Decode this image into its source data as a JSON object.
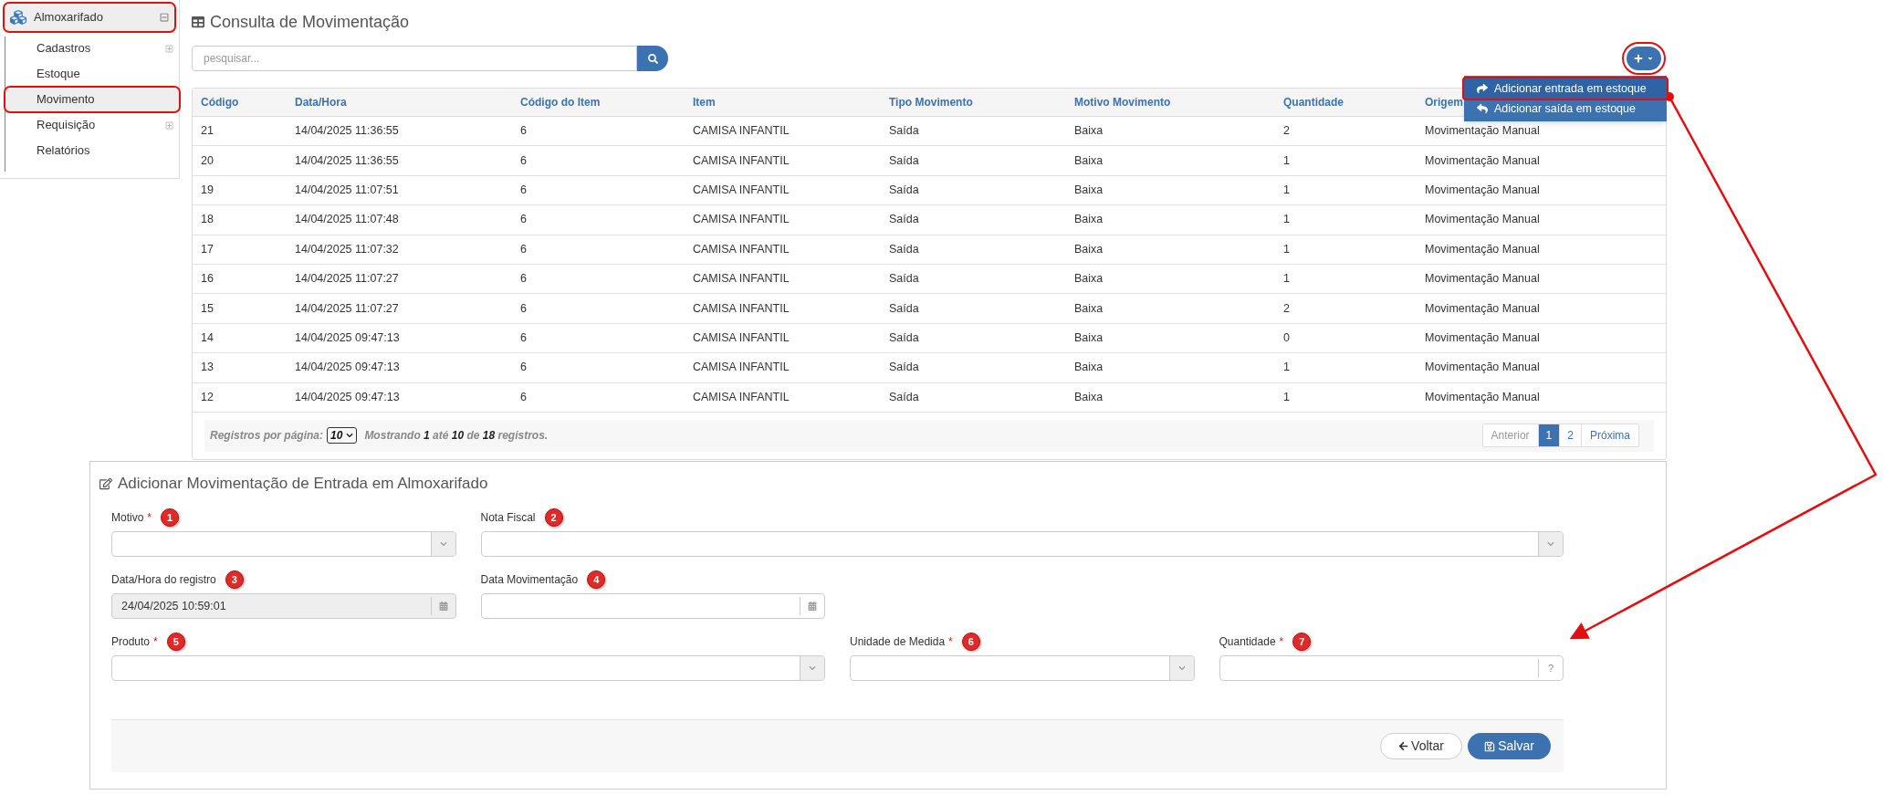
{
  "sidebar": {
    "header": {
      "label": "Almoxarifado",
      "expanded": true,
      "highlighted": true
    },
    "items": [
      {
        "label": "Cadastros",
        "kind": "group",
        "expanded": false,
        "highlighted": false
      },
      {
        "label": "Estoque",
        "kind": "link",
        "highlighted": false
      },
      {
        "label": "Movimento",
        "kind": "link",
        "highlighted": true
      },
      {
        "label": "Requisição",
        "kind": "group",
        "expanded": false,
        "highlighted": false
      },
      {
        "label": "Relatórios",
        "kind": "link",
        "highlighted": false
      }
    ]
  },
  "list": {
    "title": "Consulta de Movimentação",
    "search": {
      "placeholder": "pesquisar..."
    },
    "add_button": {
      "highlighted": true
    },
    "menu": [
      {
        "label": "Adicionar entrada em estoque",
        "kind": "entry",
        "highlighted": true
      },
      {
        "label": "Adicionar saída em estoque",
        "kind": "exit",
        "highlighted": false
      }
    ],
    "table": {
      "columns": [
        "Código",
        "Data/Hora",
        "Código do Item",
        "Item",
        "Tipo Movimento",
        "Motivo Movimento",
        "Quantidade",
        "Origem"
      ],
      "rows": [
        [
          "21",
          "14/04/2025 11:36:55",
          "6",
          "CAMISA INFANTIL",
          "Saída",
          "Baixa",
          "2",
          "Movimentação Manual"
        ],
        [
          "20",
          "14/04/2025 11:36:55",
          "6",
          "CAMISA INFANTIL",
          "Saída",
          "Baixa",
          "1",
          "Movimentação Manual"
        ],
        [
          "19",
          "14/04/2025 11:07:51",
          "6",
          "CAMISA INFANTIL",
          "Saída",
          "Baixa",
          "1",
          "Movimentação Manual"
        ],
        [
          "18",
          "14/04/2025 11:07:48",
          "6",
          "CAMISA INFANTIL",
          "Saída",
          "Baixa",
          "1",
          "Movimentação Manual"
        ],
        [
          "17",
          "14/04/2025 11:07:32",
          "6",
          "CAMISA INFANTIL",
          "Saída",
          "Baixa",
          "1",
          "Movimentação Manual"
        ],
        [
          "16",
          "14/04/2025 11:07:27",
          "6",
          "CAMISA INFANTIL",
          "Saída",
          "Baixa",
          "1",
          "Movimentação Manual"
        ],
        [
          "15",
          "14/04/2025 11:07:27",
          "6",
          "CAMISA INFANTIL",
          "Saída",
          "Baixa",
          "2",
          "Movimentação Manual"
        ],
        [
          "14",
          "14/04/2025 09:47:13",
          "6",
          "CAMISA INFANTIL",
          "Saída",
          "Baixa",
          "0",
          "Movimentação Manual"
        ],
        [
          "13",
          "14/04/2025 09:47:13",
          "6",
          "CAMISA INFANTIL",
          "Saída",
          "Baixa",
          "1",
          "Movimentação Manual"
        ],
        [
          "12",
          "14/04/2025 09:47:13",
          "6",
          "CAMISA INFANTIL",
          "Saída",
          "Baixa",
          "1",
          "Movimentação Manual"
        ]
      ]
    },
    "footer": {
      "per_page_label": "Registros por página:",
      "per_page": "10",
      "summary": "Mostrando **1** até **10** de **18** registros."
    },
    "pagination": [
      {
        "label": "Anterior",
        "kind": "nav",
        "disabled": true,
        "selected": false
      },
      {
        "label": "1",
        "kind": "page",
        "disabled": false,
        "selected": true
      },
      {
        "label": "2",
        "kind": "page",
        "disabled": false,
        "selected": false
      },
      {
        "label": "Próxima",
        "kind": "nav",
        "disabled": false,
        "selected": false
      }
    ]
  },
  "form": {
    "title": "Adicionar Movimentação de Entrada em Almoxarifado",
    "rows": [
      [
        {
          "label": "Motivo",
          "required_mark": "*",
          "marker": "1",
          "kind": "select"
        },
        {
          "label": "Nota Fiscal",
          "marker": "2",
          "kind": "select"
        }
      ],
      [
        {
          "label": "Data/Hora do registro",
          "marker": "3",
          "kind": "date",
          "value": "24/04/2025 10:59:01",
          "disabled": true
        },
        {
          "label": "Data Movimentação",
          "marker": "4",
          "kind": "date",
          "disabled": false
        }
      ],
      [
        {
          "label": "Produto",
          "required_mark": "*",
          "marker": "5",
          "kind": "select"
        },
        {
          "label": "Unidade de Medida",
          "required_mark": "*",
          "marker": "6",
          "kind": "select"
        },
        {
          "label": "Quantidade",
          "required_mark": "*",
          "marker": "7",
          "kind": "number",
          "addon": "?"
        }
      ]
    ],
    "buttons": [
      {
        "label": "Voltar",
        "kind": "back"
      },
      {
        "label": "Salvar",
        "kind": "save"
      }
    ]
  }
}
